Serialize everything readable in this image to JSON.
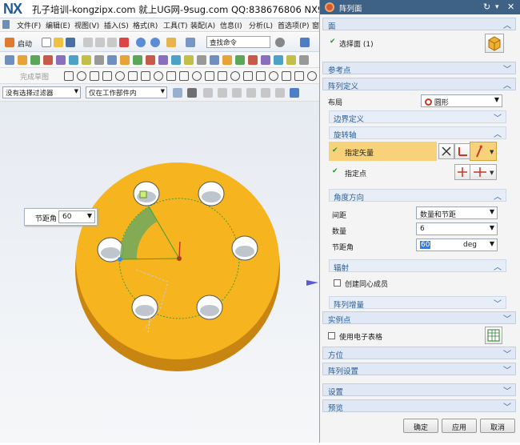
{
  "app": {
    "logo": "NX",
    "title": "孔子培训-kongzipx.com 就上UG网-9sug.com QQ:838676806 NX9 - 建"
  },
  "menu": [
    "文件(F)",
    "编辑(E)",
    "视图(V)",
    "插入(S)",
    "格式(R)",
    "工具(T)",
    "装配(A)",
    "信息(I)",
    "分析(L)",
    "首选项(P)",
    "窗"
  ],
  "toolbar": {
    "start_label": "启动",
    "command_search": "查找命令",
    "finish_sketch": "完成草图"
  },
  "filters": {
    "selection_filter": "没有选择过滤器",
    "scope": "仅在工作部件内"
  },
  "viewport": {
    "callout_label": "节距角",
    "callout_value": "60"
  },
  "dialog": {
    "title": "阵列面",
    "sections": {
      "face": "面",
      "select_face": "选择面 (1)",
      "reference_point": "参考点",
      "pattern_definition": "阵列定义",
      "layout_label": "布局",
      "layout_value": "圆形",
      "boundary": "边界定义",
      "rotation_axis": "旋转轴",
      "specify_vector": "指定矢量",
      "specify_point": "指定点",
      "angle_direction": "角度方向",
      "spacing_label": "间距",
      "spacing_value": "数量和节距",
      "count_label": "数量",
      "count_value": "6",
      "pitch_label": "节距角",
      "pitch_value": "60",
      "pitch_unit": "deg",
      "radiate": "辐射",
      "concentric": "创建同心成员",
      "increment": "阵列增量",
      "instance_points": "实例点",
      "spreadsheet": "使用电子表格",
      "orientation": "方位",
      "pattern_settings": "阵列设置",
      "settings": "设置",
      "preview": "预览"
    },
    "buttons": {
      "ok": "确定",
      "apply": "应用",
      "cancel": "取消"
    }
  },
  "colors": {
    "part": "#f5b320",
    "dialog_header": "#3d6286",
    "section_text": "#2b5c94",
    "highlight": "#f7d27a"
  }
}
